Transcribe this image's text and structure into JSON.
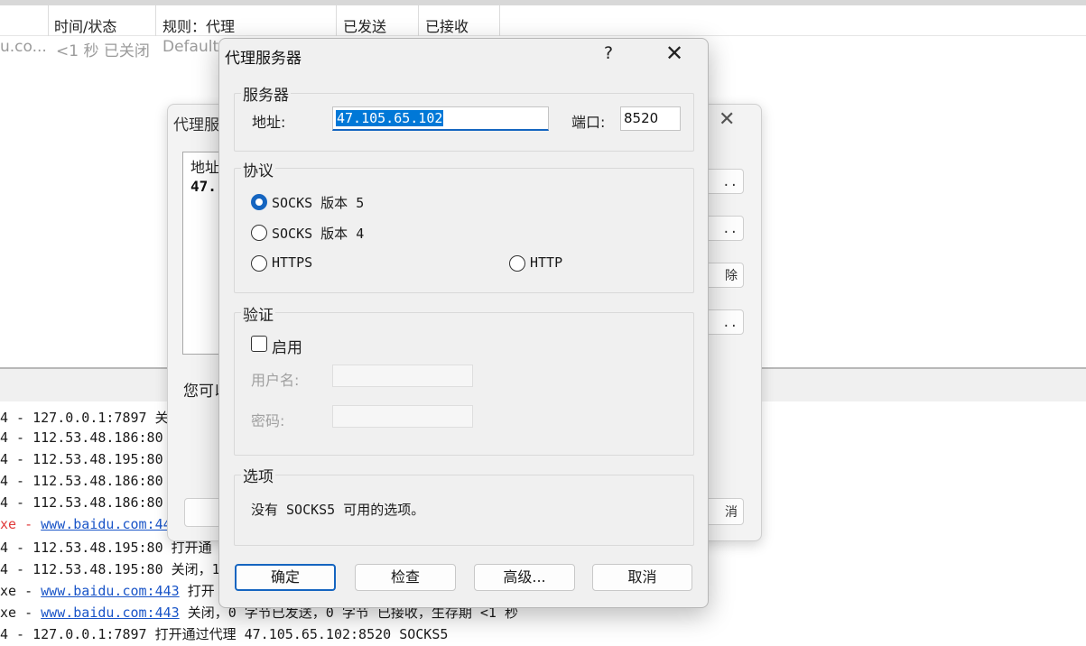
{
  "table": {
    "headers": [
      "时间/状态",
      "规则：代理",
      "已发送",
      "已接收"
    ],
    "row1": {
      "col0": "u.co...",
      "col1": "<1 秒 已关闭",
      "col2": "Default"
    }
  },
  "log": {
    "lines": [
      {
        "prefix": "4 - ",
        "text": "127.0.0.1:7897 关",
        "link": ""
      },
      {
        "prefix": "4 - ",
        "text": "112.53.48.186:80",
        "link": ""
      },
      {
        "prefix": "4 - ",
        "text": "112.53.48.195:80",
        "link": ""
      },
      {
        "prefix": "4 - ",
        "text": "112.53.48.186:80",
        "link": ""
      },
      {
        "prefix": "4 - ",
        "text": "112.53.48.186:80",
        "link": ""
      },
      {
        "prefix": "xe - ",
        "text": "",
        "link": "www.baidu.com:44"
      },
      {
        "prefix": "4 - ",
        "text": "112.53.48.195:80 打开通",
        "link": ""
      },
      {
        "prefix": "4 - ",
        "text": "112.53.48.195:80 关闭，1",
        "link": ""
      },
      {
        "prefix": "xe - ",
        "text": " 打开",
        "link": "www.baidu.com:443"
      },
      {
        "prefix": "xe - ",
        "text": " 关闭，0 字节已发送，0 字节 已接收，生存期 <1 秒",
        "link": "www.baidu.com:443"
      },
      {
        "prefix": "4 - ",
        "text": "127.0.0.1:7897 打开通过代理 47.105.65.102:8520 SOCKS5",
        "link": ""
      }
    ]
  },
  "bg_dialog": {
    "title": "代理服",
    "close": "✕",
    "list_header": "地址",
    "list_value": "47.",
    "button_dots": "..",
    "button_partial": "除",
    "hint": "您可以",
    "right_partial": "消"
  },
  "dialog": {
    "title": "代理服务器",
    "help": "?",
    "close": "✕",
    "server": {
      "group": "服务器",
      "address_label": "地址:",
      "address_value": "47.105.65.102",
      "port_label": "端口:",
      "port_value": "8520"
    },
    "protocol": {
      "group": "协议",
      "options": [
        {
          "label": "SOCKS 版本 5",
          "selected": true
        },
        {
          "label": "SOCKS 版本 4",
          "selected": false
        },
        {
          "label": "HTTPS",
          "selected": false
        },
        {
          "label": "HTTP",
          "selected": false
        }
      ]
    },
    "auth": {
      "group": "验证",
      "enable_label": "启用",
      "enabled": false,
      "username_label": "用户名:",
      "password_label": "密码:"
    },
    "options": {
      "group": "选项",
      "text": "没有 SOCKS5 可用的选项。"
    },
    "buttons": {
      "ok": "确定",
      "check": "检查",
      "advanced": "高级...",
      "cancel": "取消"
    }
  },
  "colors": {
    "accent": "#1565c0",
    "link": "#1a55c8",
    "error": "#e03a3a",
    "selection": "#0078d7"
  }
}
